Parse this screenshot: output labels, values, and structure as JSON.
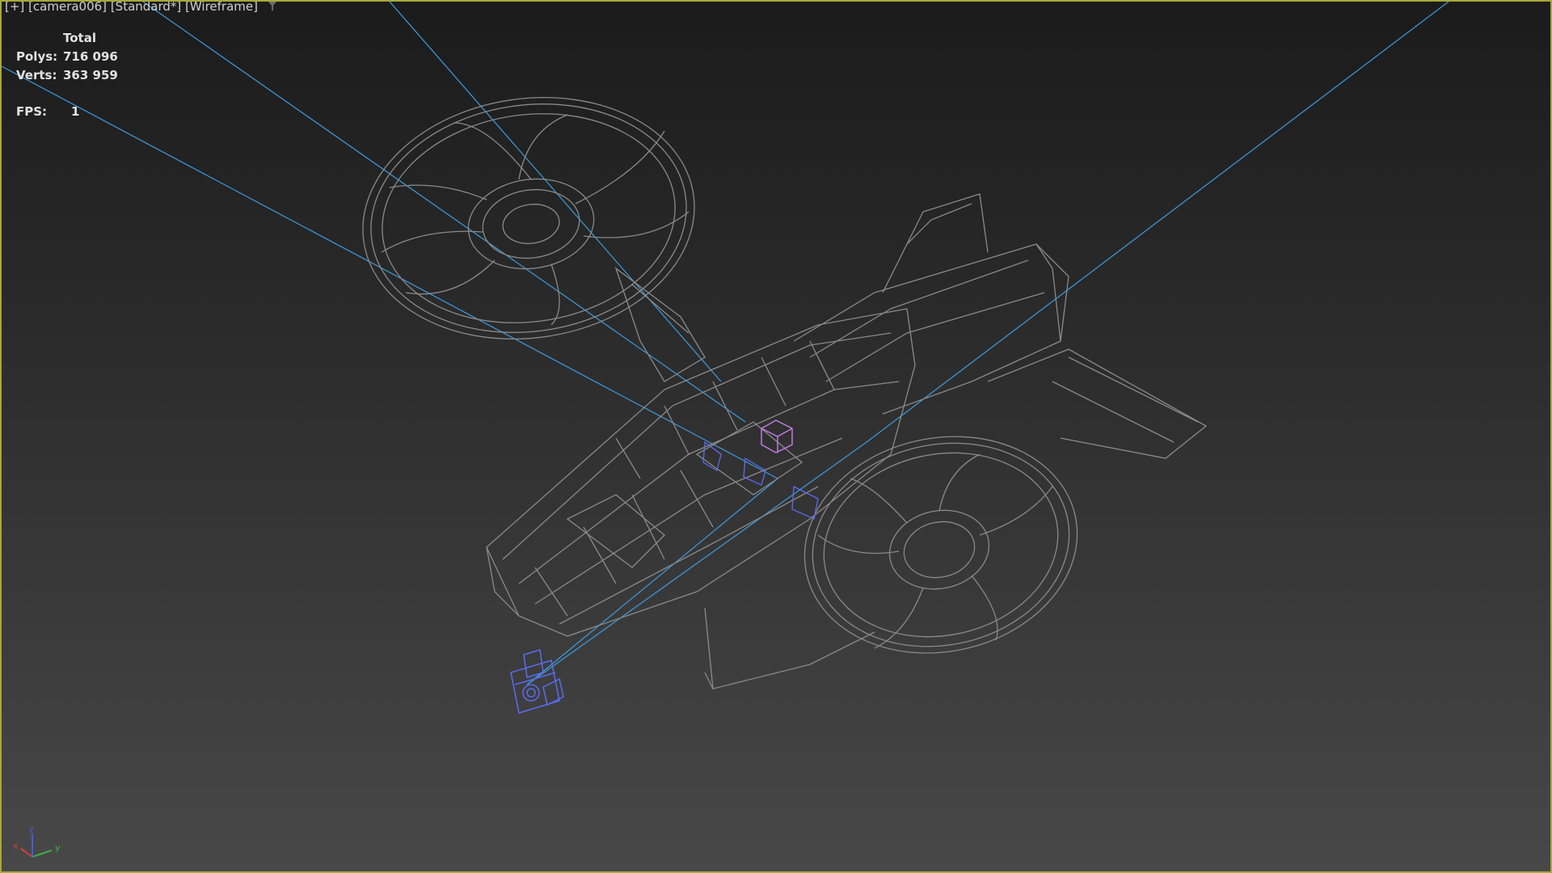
{
  "viewport": {
    "label": {
      "menu": "[+]",
      "camera": "[camera006]",
      "shading_preset": "[Standard*]",
      "display_mode": "[Wireframe]",
      "filter_icon": "funnel-icon"
    },
    "stats": {
      "header": "Total",
      "polys_label": "Polys:",
      "polys_value": "716 096",
      "verts_label": "Verts:",
      "verts_value": "363 959",
      "fps_label": "FPS:",
      "fps_value": "1"
    },
    "axis_gizmo": {
      "x": "x",
      "y": "y",
      "z": "z"
    }
  },
  "colors": {
    "viewport_border": "#a8a83a",
    "wireframe": "#8a8a8a",
    "camera_lines": "#3f9be0",
    "selection": "#5a6cf0",
    "helper": "#c07ae0"
  }
}
